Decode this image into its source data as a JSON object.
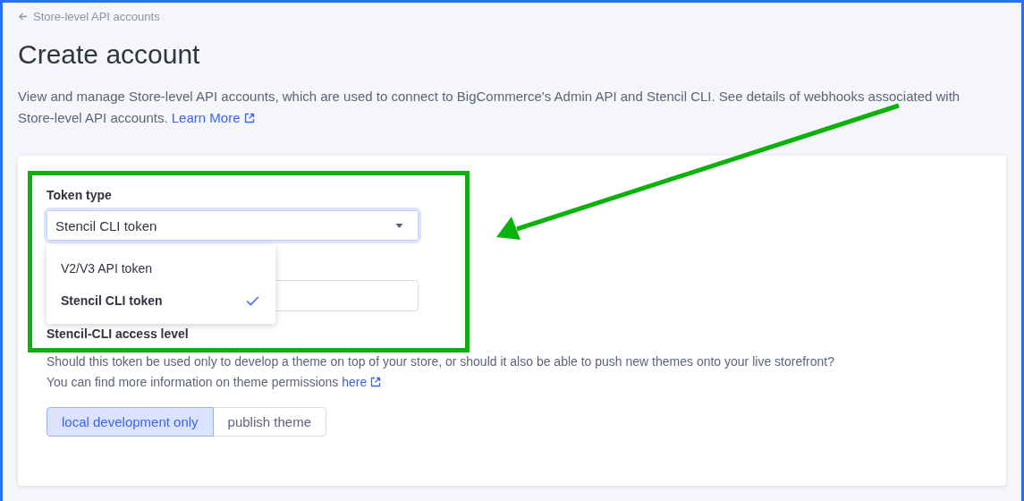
{
  "breadcrumb": {
    "label": "Store-level API accounts"
  },
  "title": "Create account",
  "description": {
    "text": "View and manage Store-level API accounts, which are used to connect to BigCommerce's Admin API and Stencil CLI. See details of webhooks associated with Store-level API accounts.",
    "link": "Learn More"
  },
  "token_type": {
    "label": "Token type",
    "value": "Stencil CLI token",
    "options": [
      {
        "label": "V2/V3 API token",
        "selected": false
      },
      {
        "label": "Stencil CLI token",
        "selected": true
      }
    ]
  },
  "access_level": {
    "label": "Stencil-CLI access level",
    "description": "Should this token be used only to develop a theme on top of your store, or should it also be able to push new themes onto your live storefront?",
    "info": "You can find more information on theme permissions",
    "link": "here",
    "options": [
      {
        "label": "local development only",
        "selected": true
      },
      {
        "label": "publish theme",
        "selected": false
      }
    ]
  }
}
